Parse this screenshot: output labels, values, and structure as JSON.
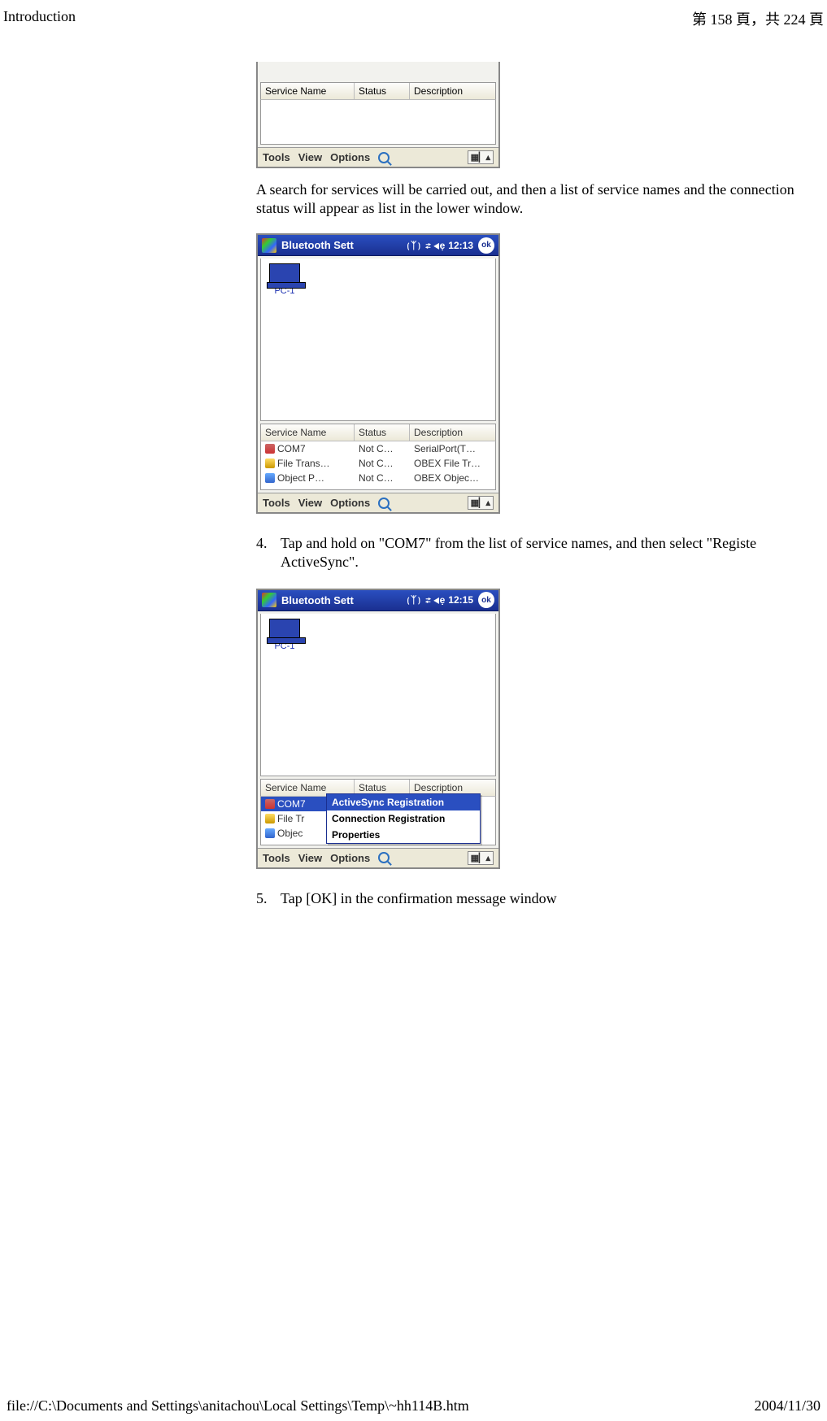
{
  "header": {
    "title": "Introduction",
    "page_info": "第 158 頁，共 224 頁"
  },
  "screens": {
    "cols": {
      "c1": "Service Name",
      "c2": "Status",
      "c3": "Description"
    },
    "bottom": {
      "tools": "Tools",
      "view": "View",
      "options": "Options",
      "sip": "▦▏▴"
    },
    "s1": {
      "title": "Bluetooth Sett",
      "time": "12:13",
      "ok": "ok",
      "signal": "⟮ᛉ⟯ ⇄ ◀ẹ",
      "device": "PC-1",
      "rows": [
        {
          "ic": "a",
          "n": "COM7",
          "s": "Not C…",
          "d": "SerialPort(T…"
        },
        {
          "ic": "b",
          "n": "File Trans…",
          "s": "Not C…",
          "d": "OBEX File Tr…"
        },
        {
          "ic": "c",
          "n": "Object P…",
          "s": "Not C…",
          "d": "OBEX Objec…"
        }
      ]
    },
    "s2": {
      "title": "Bluetooth Sett",
      "time": "12:15",
      "ok": "ok",
      "signal": "⟮ᛉ⟯ ⇄ ◀ẹ",
      "device": "PC-1",
      "rows": [
        {
          "ic": "a",
          "n": "COM7",
          "sel": true
        },
        {
          "ic": "b",
          "n": "File Tr",
          "sel": false
        },
        {
          "ic": "c",
          "n": "Objec",
          "sel": false
        }
      ],
      "menu": {
        "hdr": "ActiveSync Registration",
        "i1": "Connection Registration",
        "i2": "Properties"
      }
    }
  },
  "body": {
    "p1": "A search for services will be carried out, and then a list of service names and the connection status will appear as list in the lower window.",
    "step4_num": "4.",
    "step4": "Tap and hold on \"COM7\" from the list of service names, and then select \"Registe ActiveSync\".",
    "step5_num": "5.",
    "step5": "Tap [OK] in the confirmation message window"
  },
  "footer": {
    "path": "file://C:\\Documents and Settings\\anitachou\\Local Settings\\Temp\\~hh114B.htm",
    "date": "2004/11/30"
  }
}
